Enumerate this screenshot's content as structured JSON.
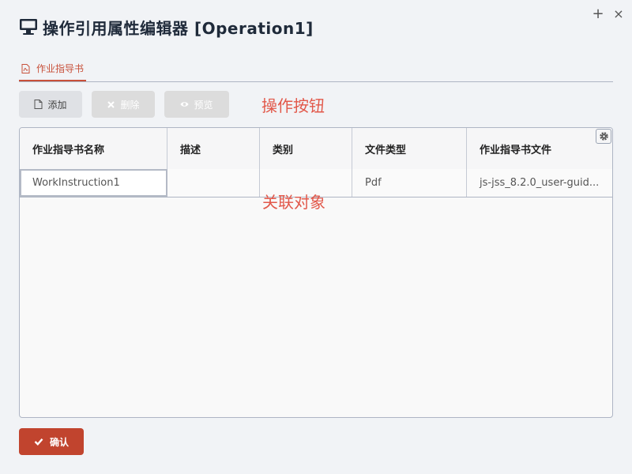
{
  "window": {
    "title": "操作引用属性编辑器 [Operation1]",
    "plus_label": "+",
    "close_label": "×"
  },
  "tabs": [
    {
      "label": "作业指导书",
      "icon": "pdf-file-icon",
      "active": true
    }
  ],
  "toolbar": {
    "add_label": "添加",
    "delete_label": "删除",
    "preview_label": "预览"
  },
  "annotations": {
    "operations": "操作按钮",
    "related": "关联对象"
  },
  "table": {
    "columns": [
      "作业指导书名称",
      "描述",
      "类别",
      "文件类型",
      "作业指导书文件"
    ],
    "rows": [
      [
        "WorkInstruction1",
        "",
        "",
        "Pdf",
        "js-jss_8.2.0_user-guid..."
      ]
    ]
  },
  "footer": {
    "confirm_label": "确认"
  },
  "colors": {
    "accent": "#c8503a",
    "confirm_bg": "#c1442e",
    "annotation": "#e2584a"
  }
}
